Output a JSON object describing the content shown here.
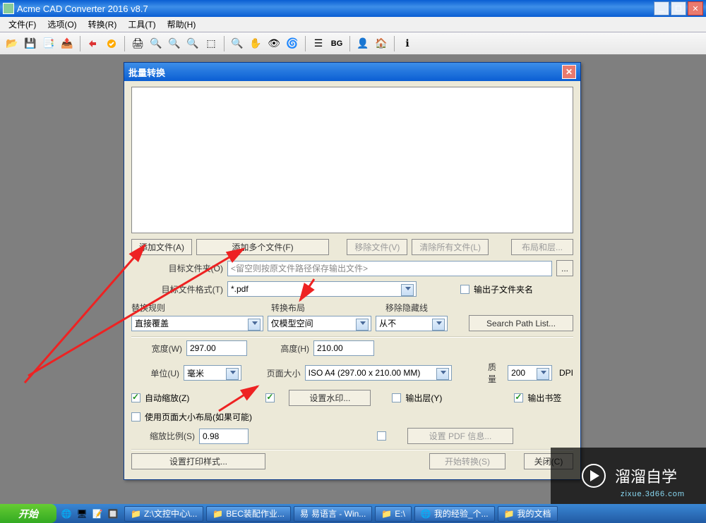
{
  "window": {
    "title": "Acme CAD Converter 2016 v8.7",
    "menu": [
      "文件(F)",
      "选项(O)",
      "转换(R)",
      "工具(T)",
      "帮助(H)"
    ]
  },
  "toolbar_icons": [
    "open-icon",
    "save-icon",
    "save-all-icon",
    "export-icon",
    "convert-icon",
    "batch-icon",
    "print-icon",
    "zoom-in-icon",
    "zoom-out-icon",
    "zoom-extents-icon",
    "region-icon",
    "zoom-window-icon",
    "pan-icon",
    "hidden-icon",
    "render-icon",
    "layers-icon",
    "bg-icon",
    "user-icon",
    "home-icon",
    "about-icon"
  ],
  "dialog": {
    "title": "批量转换",
    "buttons": {
      "add_file": "添加文件(A)",
      "add_multi": "添加多个文件(F)",
      "remove_file": "移除文件(V)",
      "clear_all": "清除所有文件(L)",
      "layouts": "布局和层...",
      "browse": "...",
      "search_path": "Search Path List...",
      "set_watermark": "设置水印...",
      "set_pdf_info": "设置 PDF 信息...",
      "print_style": "设置打印样式...",
      "start": "开始转换(S)",
      "close": "关闭(C)"
    },
    "labels": {
      "target_folder": "目标文件夹(O)",
      "target_format": "目标文件格式(T)",
      "replace_rule": "替换规则",
      "convert_layout": "转换布局",
      "remove_hidden": "移除隐藏线",
      "width": "宽度(W)",
      "height": "高度(H)",
      "unit": "单位(U)",
      "page_size": "页面大小",
      "quality": "质量",
      "dpi": "DPI",
      "auto_zoom": "自动缩放(Z)",
      "use_page_layout": "使用页面大小布局(如果可能)",
      "zoom_ratio": "缩放比例(S)",
      "output_layer": "输出层(Y)",
      "output_bookmark": "输出书签",
      "output_subfolder": "输出子文件夹名"
    },
    "values": {
      "target_folder_placeholder": "<留空则按原文件路径保存输出文件>",
      "target_format": "*.pdf",
      "replace_rule": "直接覆盖",
      "convert_layout": "仅模型空间",
      "remove_hidden": "从不",
      "width": "297.00",
      "height": "210.00",
      "unit": "毫米",
      "page_size": "ISO A4 (297.00 x 210.00 MM)",
      "quality": "200",
      "zoom_ratio": "0.98"
    },
    "checks": {
      "output_subfolder": false,
      "auto_zoom": true,
      "watermark_check": true,
      "output_layer": false,
      "output_bookmark": true,
      "use_page_layout": false,
      "pdf_info": false
    }
  },
  "taskbar": {
    "start": "开始",
    "items": [
      "Z:\\文控中心\\...",
      "BEC装配作业...",
      "易语言 - Win...",
      "E:\\",
      "我的经验_个...",
      "我的文档"
    ]
  },
  "watermark": {
    "brand": "溜溜自学",
    "url": "zixue.3d66.com"
  }
}
